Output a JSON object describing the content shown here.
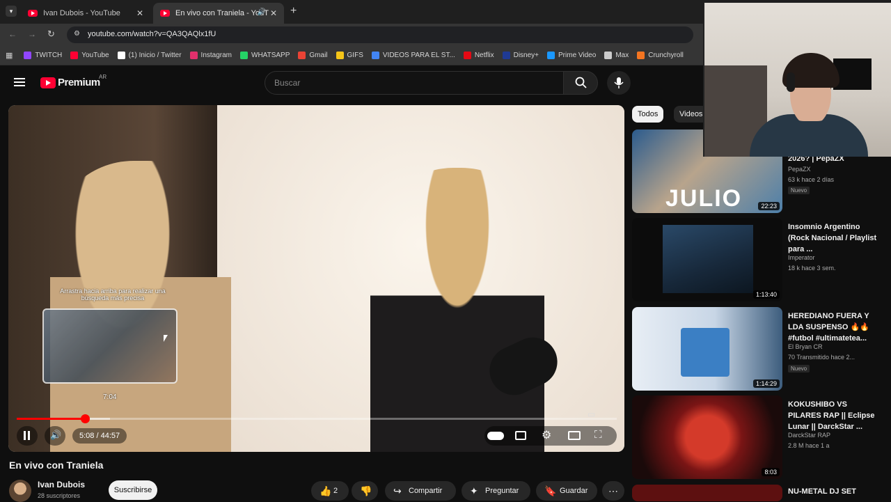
{
  "browser": {
    "tabs": [
      {
        "title": "Ivan Dubois - YouTube",
        "active": false
      },
      {
        "title": "En vivo con Traniela - YouT",
        "active": true
      }
    ],
    "url": "youtube.com/watch?v=QA3QAQlx1fU",
    "bookmarks": [
      {
        "label": "TWITCH",
        "color": "#9146ff"
      },
      {
        "label": "YouTube",
        "color": "#ff0033"
      },
      {
        "label": "(1) Inicio / Twitter",
        "color": "#ffffff"
      },
      {
        "label": "Instagram",
        "color": "#e1306c"
      },
      {
        "label": "WHATSAPP",
        "color": "#25d366"
      },
      {
        "label": "Gmail",
        "color": "#ea4335"
      },
      {
        "label": "GIFS",
        "color": "#f5c518"
      },
      {
        "label": "VIDEOS PARA EL ST...",
        "color": "#4285f4"
      },
      {
        "label": "Netflix",
        "color": "#e50914"
      },
      {
        "label": "Disney+",
        "color": "#1f3a93"
      },
      {
        "label": "Prime Video",
        "color": "#1a98ff"
      },
      {
        "label": "Max",
        "color": "#cccccc"
      },
      {
        "label": "Crunchyroll",
        "color": "#f47521"
      }
    ]
  },
  "header": {
    "logo_text": "Premium",
    "region": "AR",
    "search_placeholder": "Buscar"
  },
  "player": {
    "hint": "Arrastra hacia arriba para realizar una búsqueda más precisa",
    "preview_time": "7:04",
    "current_time": "5:08",
    "separator": "/",
    "duration": "44:57",
    "progress_fraction": 0.114,
    "buffer_fraction": 0.155
  },
  "video": {
    "title": "En vivo con Traniela",
    "channel": "Ivan Dubois",
    "subscribers": "28 suscriptores",
    "subscribe_label": "Suscribirse",
    "likes": "2",
    "share_label": "Compartir",
    "ask_label": "Preguntar",
    "save_label": "Guardar"
  },
  "sidebar": {
    "chips": [
      "Todos",
      "Videos"
    ],
    "items": [
      {
        "title": "2026? | PepaZX",
        "channel": "PepaZX",
        "meta": "63 k  hace 2 días",
        "badge": "Nuevo",
        "duration": "22:23",
        "thumb_color": "#3f6fa8"
      },
      {
        "title": "Insomnio Argentino (Rock Nacional / Playlist para ...",
        "channel": "Imperator",
        "meta": "18 k  hace 3 sem.",
        "badge": "",
        "duration": "1:13:40",
        "thumb_color": "#1b2a3b"
      },
      {
        "title": "HEREDIANO FUERA Y LDA SUSPENSO 🔥🔥 #futbol #ultimateteа...",
        "channel": "El Bryan CR",
        "meta": "70  Transmitido hace 2...",
        "badge": "Nuevo",
        "duration": "1:14:29",
        "thumb_color": "#2f6fae"
      },
      {
        "title": "KOKUSHIBO VS PILARES RAP || Eclipse Lunar || DarckStar ...",
        "channel": "DarckStar RAP",
        "meta": "2.8 M  hace 1 a",
        "badge": "",
        "duration": "8:03",
        "thumb_color": "#8e1a1a"
      },
      {
        "title": "NU-METAL DJ SET",
        "channel": "",
        "meta": "",
        "badge": "",
        "duration": "",
        "thumb_color": "#6b1212"
      }
    ]
  }
}
